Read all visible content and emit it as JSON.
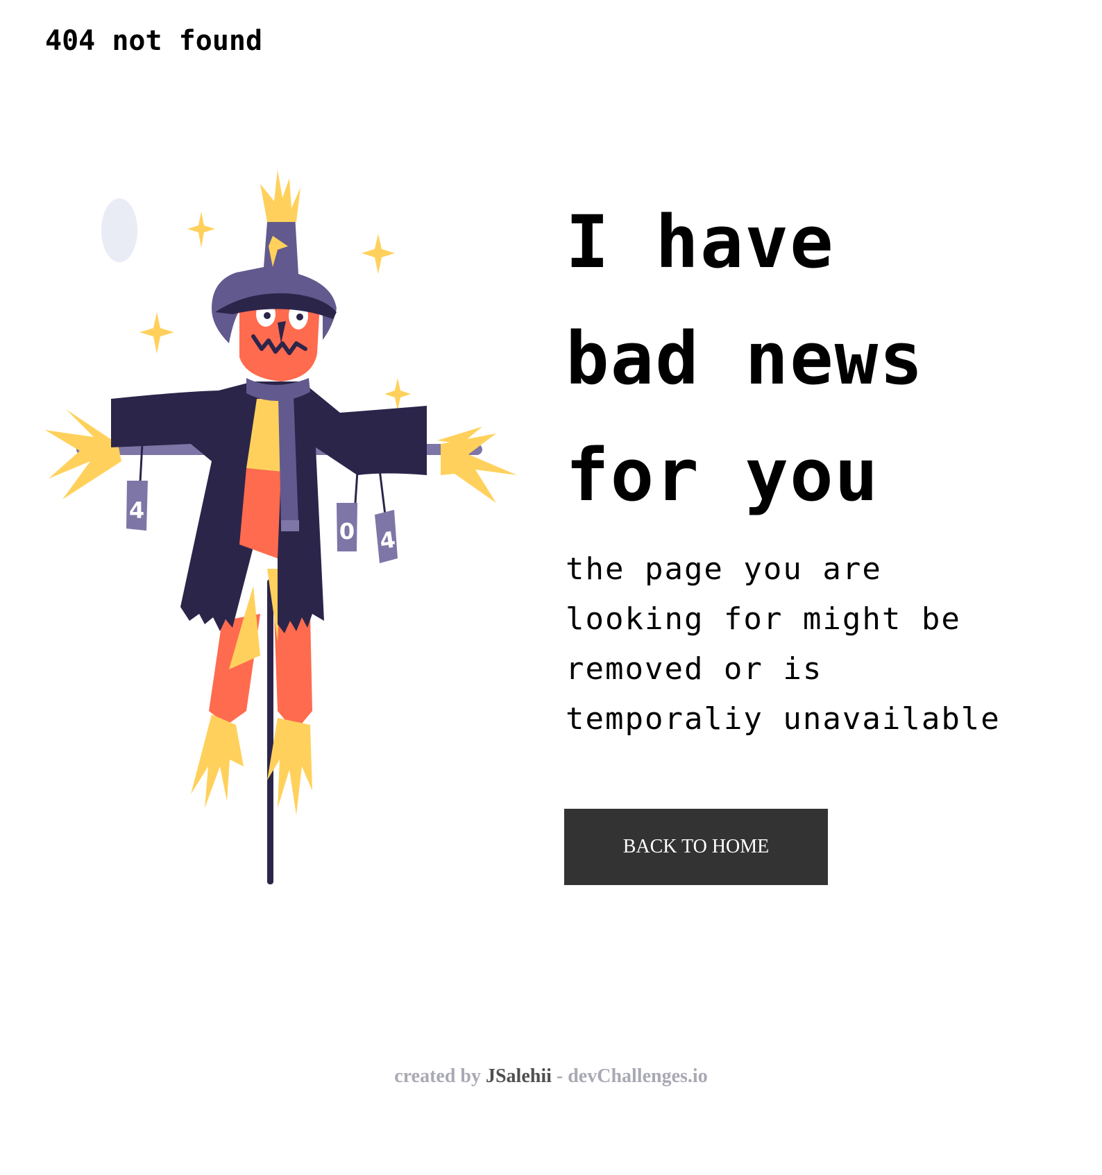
{
  "header": {
    "brand": "404 not found"
  },
  "main": {
    "headline_lines": [
      "I have",
      "bad news",
      "for you"
    ],
    "message_lines": [
      "the page you are",
      "looking for might be",
      "removed or is",
      "temporaliy unavailable"
    ],
    "home_button_label": "BACK TO HOME"
  },
  "illustration": {
    "cans": [
      "4",
      "0",
      "4"
    ]
  },
  "footer": {
    "prefix": "created by",
    "author": "JSalehii",
    "separator": "-",
    "site": "devChallenges.io"
  },
  "colors": {
    "button_bg": "#333333",
    "coat": "#2C254A",
    "hat": "#625A8E",
    "face": "#FF6B4F",
    "straw": "#FFD15C",
    "footer_text": "#A9A9B4",
    "footer_author": "#4F4F4F"
  }
}
